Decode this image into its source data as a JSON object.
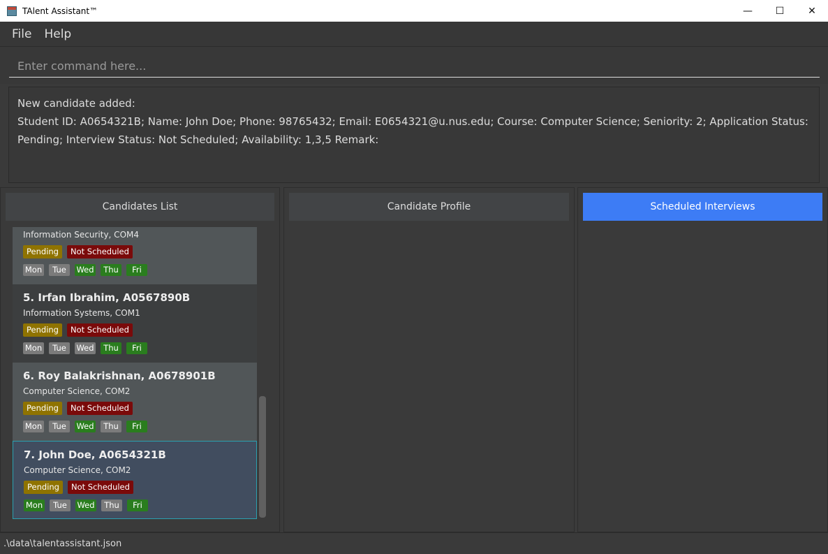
{
  "window": {
    "title": "TAlent Assistant™",
    "minimize": "—",
    "maximize": "☐",
    "close": "✕"
  },
  "menu": [
    "File",
    "Help"
  ],
  "command": {
    "placeholder": "Enter command here...",
    "value": ""
  },
  "result": {
    "lines": [
      "New candidate added:",
      "Student ID: A0654321B; Name: John Doe; Phone: 98765432; Email: E0654321@u.nus.edu; Course: Computer Science; Seniority: 2; Application Status: Pending; Interview Status: Not Scheduled; Availability: 1,3,5 Remark:"
    ]
  },
  "panels": {
    "candidates": "Candidates List",
    "profile": "Candidate Profile",
    "interviews": "Scheduled Interviews"
  },
  "colors": {
    "pending": "#8f7300",
    "not_scheduled": "#7a0a0a",
    "available": "#2a7d1e",
    "unavailable": "#7b7b7b",
    "accent": "#3d7cf5"
  },
  "days": [
    "Mon",
    "Tue",
    "Wed",
    "Thu",
    "Fri"
  ],
  "candidates": [
    {
      "name": "",
      "sub": "Information Security, COM4",
      "app": "Pending",
      "interview": "Not Scheduled",
      "avail": [
        false,
        false,
        true,
        true,
        true
      ]
    },
    {
      "name": "5.  Irfan Ibrahim, A0567890B",
      "sub": "Information Systems, COM1",
      "app": "Pending",
      "interview": "Not Scheduled",
      "avail": [
        false,
        false,
        false,
        true,
        true
      ]
    },
    {
      "name": "6.  Roy Balakrishnan, A0678901B",
      "sub": "Computer Science, COM2",
      "app": "Pending",
      "interview": "Not Scheduled",
      "avail": [
        false,
        false,
        true,
        false,
        true
      ]
    },
    {
      "name": "7.  John Doe, A0654321B",
      "sub": "Computer Science, COM2",
      "app": "Pending",
      "interview": "Not Scheduled",
      "avail": [
        true,
        false,
        true,
        false,
        true
      ],
      "selected": true
    }
  ],
  "status": ".\\data\\talentassistant.json"
}
